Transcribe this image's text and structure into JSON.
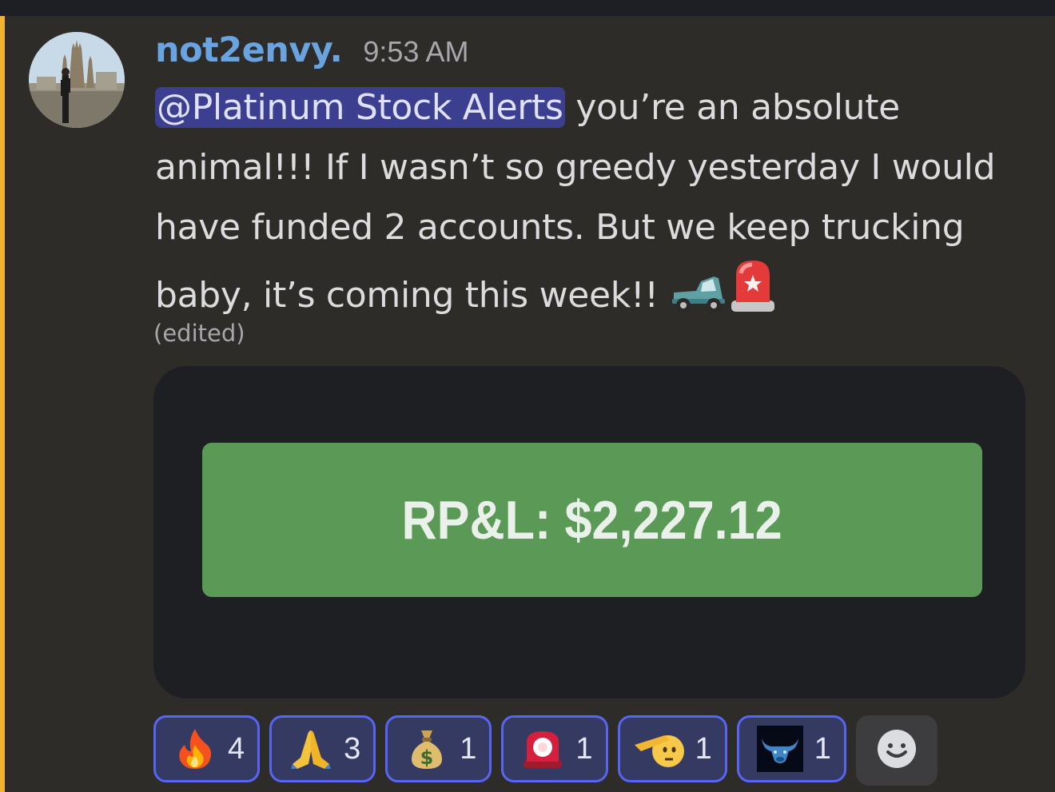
{
  "theme": {
    "accent_bar": "#f0b232",
    "username_color": "#6aa4e0",
    "mention_bg": "#3c3f8f",
    "pnl_green": "#5a9a56",
    "reaction_border": "#5865f2"
  },
  "message": {
    "username": "not2envy.",
    "timestamp": "9:53 AM",
    "mention": "@Platinum Stock Alerts",
    "text": " you’re an absolute animal!!! If I wasn’t so greedy yesterday I would have funded 2 accounts. But we keep trucking baby, it’s coming this week!! ",
    "trailing_emojis": [
      "pickup-truck",
      "rotating-light"
    ],
    "edited_label": "(edited)"
  },
  "embed": {
    "pnl_text": "RP&L: $2,227.12"
  },
  "reactions": [
    {
      "emoji": "fire",
      "count": "4"
    },
    {
      "emoji": "folded-hands",
      "count": "3"
    },
    {
      "emoji": "money-bag",
      "count": "1"
    },
    {
      "emoji": "rotating-light",
      "count": "1"
    },
    {
      "emoji": "saluting-face",
      "count": "1"
    },
    {
      "emoji": "bull-custom",
      "count": "1"
    }
  ],
  "add_reaction_icon": "smiley-face-icon"
}
